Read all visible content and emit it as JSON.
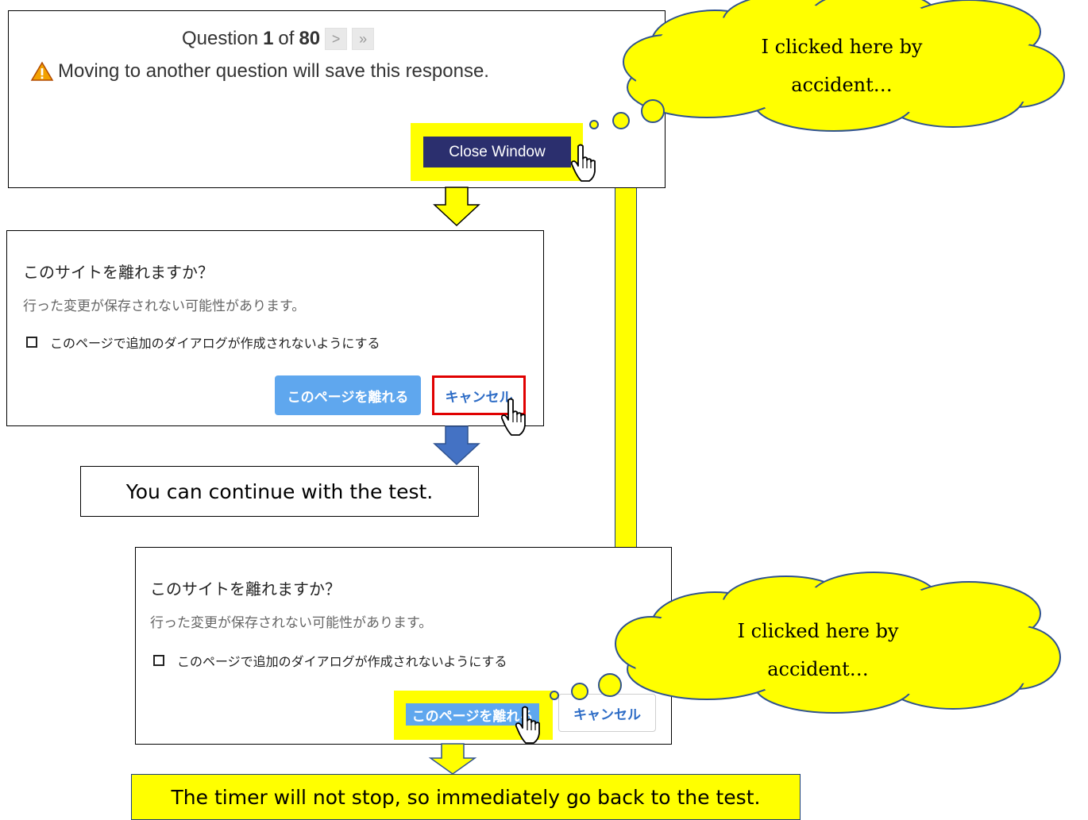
{
  "panel1": {
    "question_prefix": "Question",
    "question_number": "1",
    "question_of": "of",
    "question_total": "80",
    "next_glyph": ">",
    "last_glyph": "»",
    "warning_text": "Moving to another question will save this response.",
    "close_button_label": "Close Window"
  },
  "callouts": {
    "top": [
      "I clicked here by",
      "accident…"
    ],
    "bottom": [
      "I clicked here by",
      "accident…"
    ]
  },
  "dialog1": {
    "title": "このサイトを離れますか？",
    "subtitle": "行った変更が保存されない可能性があります。",
    "checkbox_label": "このページで追加のダイアログが作成されないようにする",
    "leave_button": "このページを離れる",
    "cancel_button": "キャンセル"
  },
  "dialog2": {
    "title": "このサイトを離れますか？",
    "subtitle": "行った変更が保存されない可能性があります。",
    "checkbox_label": "このページで追加のダイアログが作成されないようにする",
    "leave_button": "このページを離れる",
    "cancel_button": "キャンセル"
  },
  "messages": {
    "continue": "You can continue with the test.",
    "timer": "The timer will not stop, so immediately go back to the test."
  },
  "colors": {
    "highlight": "#ffff00",
    "close_button_bg": "#2b2f6e",
    "leave_button_bg": "#5fa7ee",
    "cancel_text": "#2d6cc6",
    "cancel_outline": "#e00000",
    "blue_arrow": "#4472c4",
    "cloud_outline": "#2f528f"
  }
}
